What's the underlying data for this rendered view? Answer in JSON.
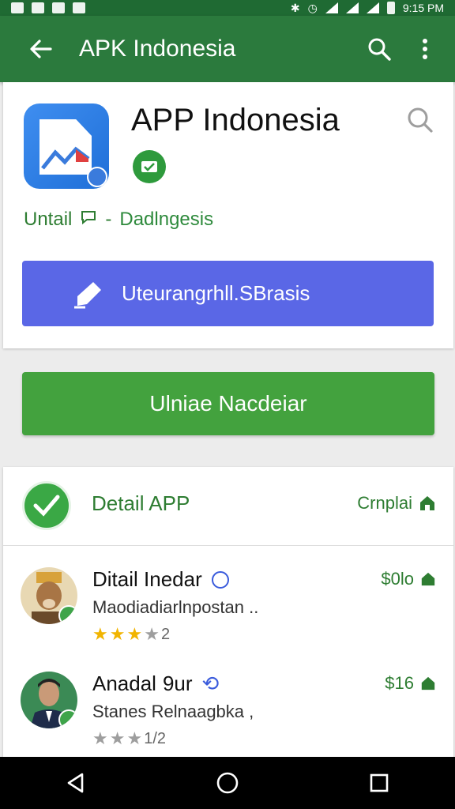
{
  "status_bar": {
    "time": "9:15 PM",
    "icons": [
      "notification-icon",
      "notification-icon",
      "notification-icon",
      "notification-icon",
      "bluetooth-icon",
      "alarm-icon",
      "wifi-icon",
      "signal-icon",
      "signal-icon",
      "battery-icon"
    ]
  },
  "appbar": {
    "title": "APK Indonesia",
    "icons": [
      "back-arrow-icon",
      "search-icon",
      "more-vert-icon"
    ]
  },
  "app": {
    "name": "APP Indonesia",
    "developer_prefix": "Untail",
    "developer_sep": "-",
    "developer": "Dadlngesis",
    "install_label": "Uteurangrhll.SBrasis"
  },
  "primary_button": "Ulniae Nacdeiar",
  "detail": {
    "title": "Detail APP",
    "action": "Crnplai"
  },
  "reviews": [
    {
      "name": "Ditail Inedar",
      "text": "Maodiadiarlnpostan ..",
      "rating": 3,
      "rating_text": "2",
      "price": "$0lo"
    },
    {
      "name": "Anadal",
      "tag": "9ur",
      "text": "Stanes Relnaagbka ,",
      "rating": 3,
      "rating_text": "1/2",
      "price": "$16"
    }
  ],
  "colors": {
    "appbar": "#2b7a3d",
    "accent_green": "#43a23e",
    "accent_blue": "#5a67e6"
  }
}
